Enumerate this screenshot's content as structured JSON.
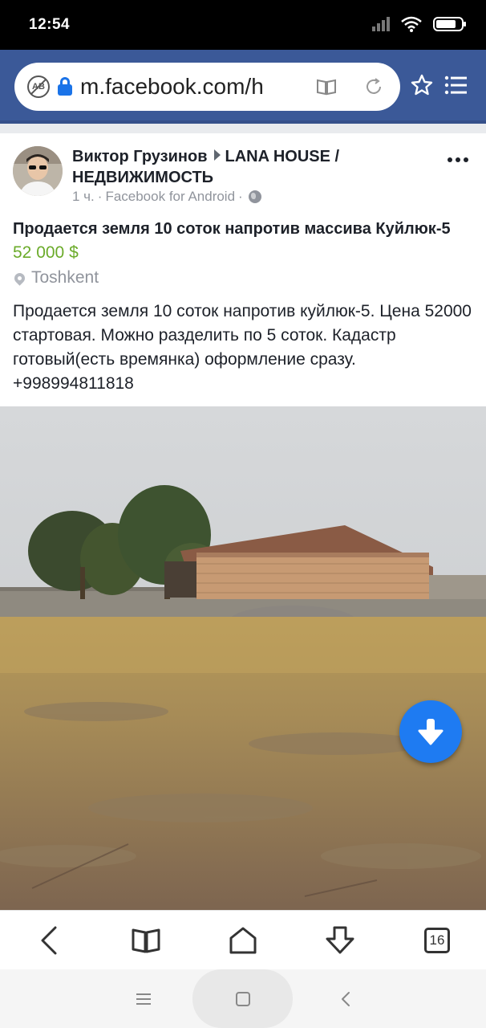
{
  "status_bar": {
    "time": "12:54",
    "icons": [
      "signal-icon",
      "wifi-icon",
      "battery-icon"
    ]
  },
  "browser": {
    "url": "m.facebook.com/h",
    "icons": [
      "adblock-icon",
      "lock-icon",
      "reader-mode-icon",
      "reload-icon",
      "star-icon",
      "menu-list-icon"
    ],
    "accent_color": "#3b5998"
  },
  "post": {
    "author": "Виктор Грузинов",
    "group": "LANA HOUSE / НЕДВИЖИМОСТЬ",
    "time_ago": "1 ч.",
    "source": "Facebook for Android",
    "separator": "·",
    "listing_title": "Продается земля 10 соток напротив массива Куйлюк-5",
    "price": "52 000 $",
    "price_color": "#6bab2a",
    "location": "Toshkent",
    "description": "Продается земля 10 соток напротив куйлюк-5. Цена 52000 стартовая. Можно разделить по 5 соток. Кадастр готовый(есть времянка) оформление сразу. +998994811818"
  },
  "toolbar": {
    "items": [
      "back-icon",
      "bookmarks-icon",
      "home-icon",
      "download-icon",
      "tabs-icon"
    ],
    "tabs_count": "16"
  },
  "nav_bar": {
    "items": [
      "recents-icon",
      "home-icon",
      "back-icon"
    ]
  }
}
